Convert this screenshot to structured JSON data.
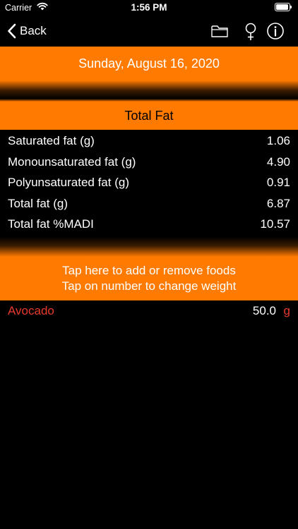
{
  "status_bar": {
    "carrier": "Carrier",
    "time": "1:56 PM"
  },
  "nav": {
    "back_label": "Back",
    "icons": [
      "folder-icon",
      "female-symbol-icon",
      "info-icon"
    ]
  },
  "date": "Sunday, August 16, 2020",
  "section_title": "Total Fat",
  "nutrients": [
    {
      "name": "Saturated fat (g)",
      "value": "1.06"
    },
    {
      "name": "Monounsaturated fat (g)",
      "value": "4.90"
    },
    {
      "name": "Polyunsaturated fat (g)",
      "value": "0.91"
    },
    {
      "name": "Total fat (g)",
      "value": "6.87"
    },
    {
      "name": "Total fat %MADI",
      "value": "10.57"
    }
  ],
  "add_foods": {
    "line1": "Tap here to add or remove foods",
    "line2": "Tap on number to change weight"
  },
  "foods": [
    {
      "name": "Avocado",
      "weight": "50.0",
      "unit": "g"
    }
  ],
  "colors": {
    "accent": "#ff7a00",
    "background": "#000000",
    "food_name": "#e8392b"
  }
}
